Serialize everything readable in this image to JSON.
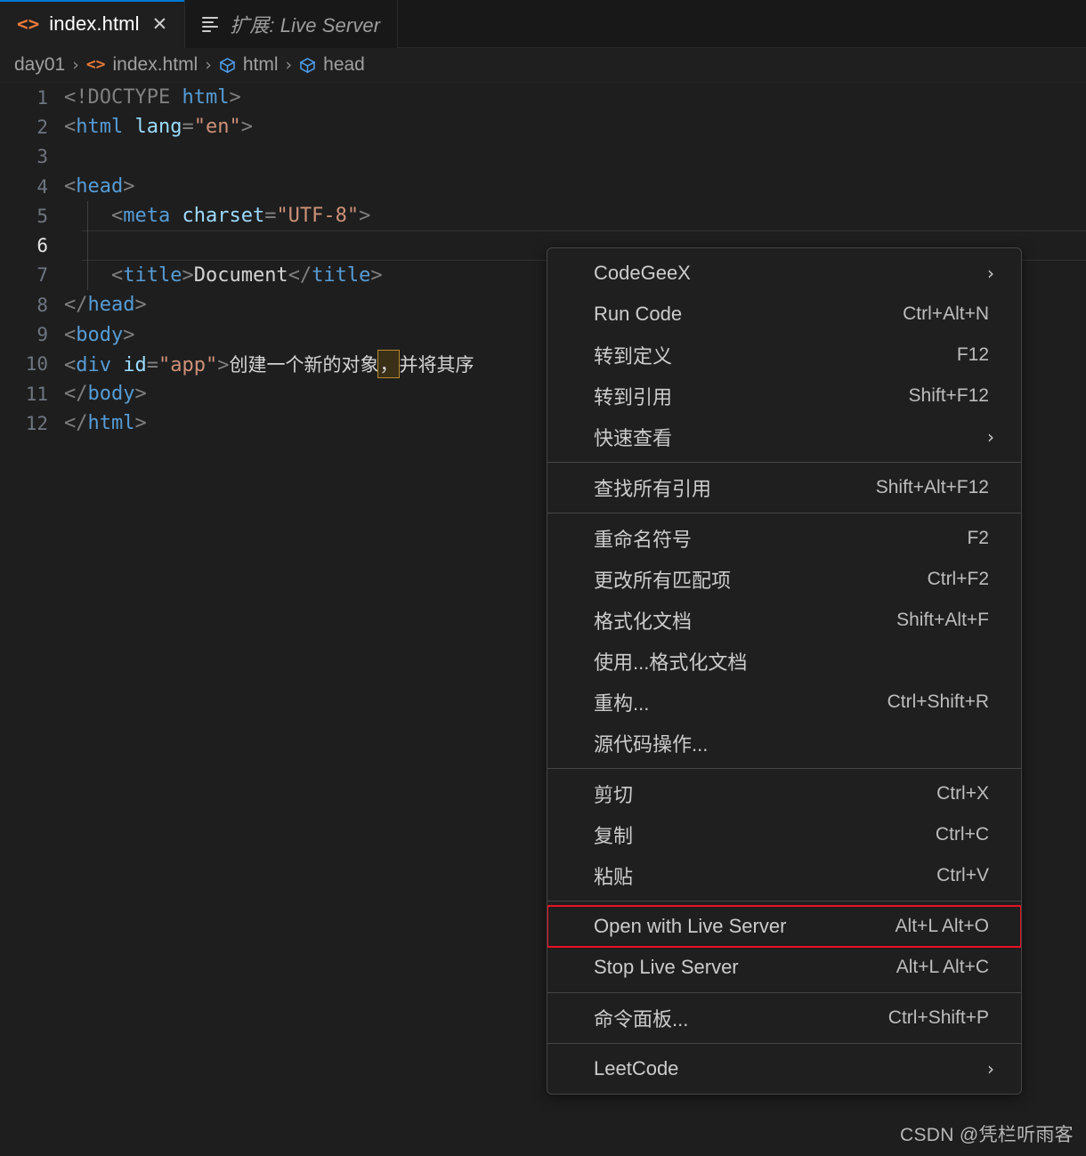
{
  "tabs": [
    {
      "label": "index.html",
      "icon": "html-file-icon",
      "active": true,
      "closable": true,
      "close_glyph": "✕"
    },
    {
      "label": "扩展: Live Server",
      "icon": "extensions-icon",
      "active": false,
      "closable": false
    }
  ],
  "breadcrumb": {
    "items": [
      {
        "label": "day01",
        "icon": "none"
      },
      {
        "label": "index.html",
        "icon": "html-file-icon"
      },
      {
        "label": "html",
        "icon": "symbol-cube-icon"
      },
      {
        "label": "head",
        "icon": "symbol-cube-icon"
      }
    ],
    "separator": "›"
  },
  "editor": {
    "active_line": 6,
    "lines": [
      {
        "n": "1",
        "indent": 0,
        "segs": [
          {
            "t": "<!DOCTYPE ",
            "c": "punct"
          },
          {
            "t": "html",
            "c": "tagb"
          },
          {
            "t": ">",
            "c": "punct"
          }
        ]
      },
      {
        "n": "2",
        "indent": 0,
        "segs": [
          {
            "t": "<",
            "c": "punct"
          },
          {
            "t": "html ",
            "c": "tagb"
          },
          {
            "t": "lang",
            "c": "attr"
          },
          {
            "t": "=",
            "c": "punct"
          },
          {
            "t": "\"en\"",
            "c": "str"
          },
          {
            "t": ">",
            "c": "punct"
          }
        ]
      },
      {
        "n": "3",
        "indent": 0,
        "segs": []
      },
      {
        "n": "4",
        "indent": 0,
        "segs": [
          {
            "t": "<",
            "c": "punct"
          },
          {
            "t": "head",
            "c": "tagb"
          },
          {
            "t": ">",
            "c": "punct"
          }
        ]
      },
      {
        "n": "5",
        "indent": 1,
        "segs": [
          {
            "t": "    <",
            "c": "punct"
          },
          {
            "t": "meta ",
            "c": "tagb"
          },
          {
            "t": "charset",
            "c": "attr"
          },
          {
            "t": "=",
            "c": "punct"
          },
          {
            "t": "\"UTF-8\"",
            "c": "str"
          },
          {
            "t": ">",
            "c": "punct"
          }
        ]
      },
      {
        "n": "6",
        "indent": 1,
        "segs": []
      },
      {
        "n": "7",
        "indent": 1,
        "segs": [
          {
            "t": "    <",
            "c": "punct"
          },
          {
            "t": "title",
            "c": "tagb"
          },
          {
            "t": ">",
            "c": "punct"
          },
          {
            "t": "Document",
            "c": "txt"
          },
          {
            "t": "</",
            "c": "punct"
          },
          {
            "t": "title",
            "c": "tagb"
          },
          {
            "t": ">",
            "c": "punct"
          }
        ]
      },
      {
        "n": "8",
        "indent": 0,
        "segs": [
          {
            "t": "</",
            "c": "punct"
          },
          {
            "t": "head",
            "c": "tagb"
          },
          {
            "t": ">",
            "c": "punct"
          }
        ]
      },
      {
        "n": "9",
        "indent": 0,
        "segs": [
          {
            "t": "<",
            "c": "punct"
          },
          {
            "t": "body",
            "c": "tagb"
          },
          {
            "t": ">",
            "c": "punct"
          }
        ]
      },
      {
        "n": "10",
        "indent": 0,
        "segs": [
          {
            "t": "<",
            "c": "punct"
          },
          {
            "t": "div ",
            "c": "tagb"
          },
          {
            "t": "id",
            "c": "attr"
          },
          {
            "t": "=",
            "c": "punct"
          },
          {
            "t": "\"app\"",
            "c": "str"
          },
          {
            "t": ">",
            "c": "punct"
          },
          {
            "t": "创建一个新的对象",
            "c": "cn"
          },
          {
            "t": "，",
            "c": "cn",
            "box": true
          },
          {
            "t": "并将其序",
            "c": "cn"
          }
        ]
      },
      {
        "n": "11",
        "indent": 0,
        "segs": [
          {
            "t": "</",
            "c": "punct"
          },
          {
            "t": "body",
            "c": "tagb"
          },
          {
            "t": ">",
            "c": "punct"
          }
        ]
      },
      {
        "n": "12",
        "indent": 0,
        "segs": [
          {
            "t": "</",
            "c": "punct"
          },
          {
            "t": "html",
            "c": "tagb"
          },
          {
            "t": ">",
            "c": "punct"
          }
        ]
      }
    ]
  },
  "context_menu": {
    "highlight_color": "#e81123",
    "groups": [
      {
        "items": [
          {
            "label": "CodeGeeX",
            "key": "",
            "submenu": true
          },
          {
            "label": "Run Code",
            "key": "Ctrl+Alt+N",
            "submenu": false
          },
          {
            "label": "转到定义",
            "key": "F12",
            "submenu": false
          },
          {
            "label": "转到引用",
            "key": "Shift+F12",
            "submenu": false
          },
          {
            "label": "快速查看",
            "key": "",
            "submenu": true
          }
        ]
      },
      {
        "items": [
          {
            "label": "查找所有引用",
            "key": "Shift+Alt+F12",
            "submenu": false
          }
        ]
      },
      {
        "items": [
          {
            "label": "重命名符号",
            "key": "F2",
            "submenu": false
          },
          {
            "label": "更改所有匹配项",
            "key": "Ctrl+F2",
            "submenu": false
          },
          {
            "label": "格式化文档",
            "key": "Shift+Alt+F",
            "submenu": false
          },
          {
            "label": "使用...格式化文档",
            "key": "",
            "submenu": false
          },
          {
            "label": "重构...",
            "key": "Ctrl+Shift+R",
            "submenu": false
          },
          {
            "label": "源代码操作...",
            "key": "",
            "submenu": false
          }
        ]
      },
      {
        "items": [
          {
            "label": "剪切",
            "key": "Ctrl+X",
            "submenu": false
          },
          {
            "label": "复制",
            "key": "Ctrl+C",
            "submenu": false
          },
          {
            "label": "粘贴",
            "key": "Ctrl+V",
            "submenu": false
          }
        ]
      },
      {
        "items": [
          {
            "label": "Open with Live Server",
            "key": "Alt+L Alt+O",
            "submenu": false,
            "highlighted": true
          },
          {
            "label": "Stop Live Server",
            "key": "Alt+L Alt+C",
            "submenu": false
          }
        ]
      },
      {
        "items": [
          {
            "label": "命令面板...",
            "key": "Ctrl+Shift+P",
            "submenu": false
          }
        ]
      },
      {
        "items": [
          {
            "label": "LeetCode",
            "key": "",
            "submenu": true
          }
        ]
      }
    ],
    "submenu_glyph": "›"
  },
  "watermark": {
    "text": "CSDN @凭栏听雨客"
  }
}
